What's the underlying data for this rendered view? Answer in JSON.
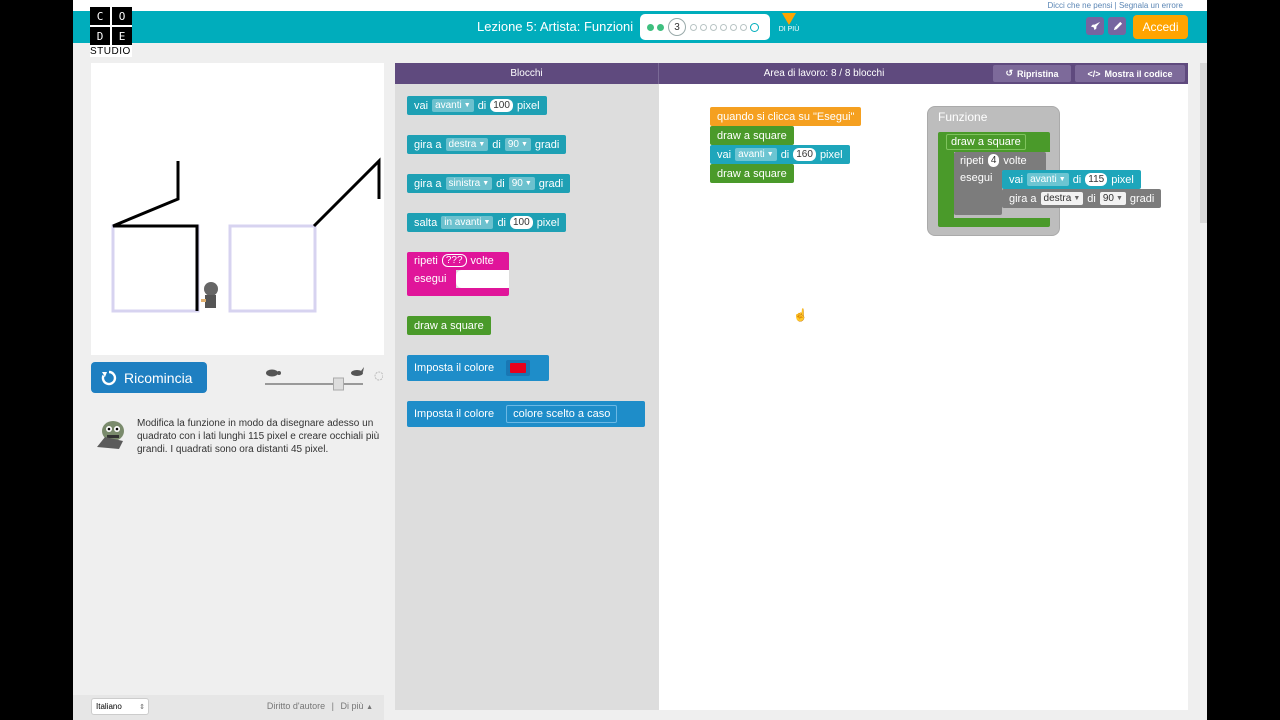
{
  "top_links": "Dicci che ne pensi | Segnala un errore",
  "logo": {
    "letters": [
      "C",
      "O",
      "D",
      "E"
    ],
    "studio": "STUDIO"
  },
  "header": {
    "title": "Lezione 5: Artista: Funzioni",
    "current_step": "3",
    "more_label": "DI PIÙ",
    "login_label": "Accedi"
  },
  "left": {
    "reset_label": "Ricomincia",
    "instructions": "Modifica la funzione in modo da disegnare adesso un quadrato con i lati lunghi 115 pixel e creare occhiali più grandi. I quadrati sono ora distanti 45 pixel.",
    "speed_level": 0.75
  },
  "footer": {
    "language": "Italiano",
    "copyright": "Diritto d'autore",
    "more": "Di più"
  },
  "toolbox": {
    "header": "Blocchi",
    "blocks": {
      "move": {
        "verb": "vai",
        "dir": "avanti",
        "di": "di",
        "value": "100",
        "unit": "pixel"
      },
      "turn_right": {
        "verb": "gira a",
        "dir": "destra",
        "di": "di",
        "value": "90",
        "unit": "gradi"
      },
      "turn_left": {
        "verb": "gira a",
        "dir": "sinistra",
        "di": "di",
        "value": "90",
        "unit": "gradi"
      },
      "jump": {
        "verb": "salta",
        "dir": "in avanti",
        "di": "di",
        "value": "100",
        "unit": "pixel"
      },
      "repeat": {
        "label": "ripeti",
        "value": "???",
        "unit": "volte",
        "do": "esegui"
      },
      "draw_square": "draw a square",
      "set_color": "Imposta il colore",
      "set_color_random": {
        "label": "Imposta il colore",
        "value": "colore scelto a caso"
      }
    }
  },
  "workspace": {
    "header": "Area di lavoro: 8 / 8 blocchi",
    "reset_label": "Ripristina",
    "code_label": "Mostra il codice",
    "main": {
      "event": "quando si clicca su \"Esegui\"",
      "call1": "draw a square",
      "move": {
        "verb": "vai",
        "dir": "avanti",
        "di": "di",
        "value": "160",
        "unit": "pixel"
      },
      "call2": "draw a square"
    },
    "function": {
      "title": "Funzione",
      "name": "draw a square",
      "repeat": {
        "label": "ripeti",
        "value": "4",
        "unit": "volte",
        "do": "esegui"
      },
      "move": {
        "verb": "vai",
        "dir": "avanti",
        "di": "di",
        "value": "115",
        "unit": "pixel"
      },
      "turn": {
        "verb": "gira a",
        "dir": "destra",
        "di": "di",
        "value": "90",
        "unit": "gradi"
      }
    }
  },
  "colors": {
    "header": "#00adbc",
    "toolbar": "#5f4a7e",
    "login": "#ffa400",
    "selected_color": "#e8001c"
  }
}
